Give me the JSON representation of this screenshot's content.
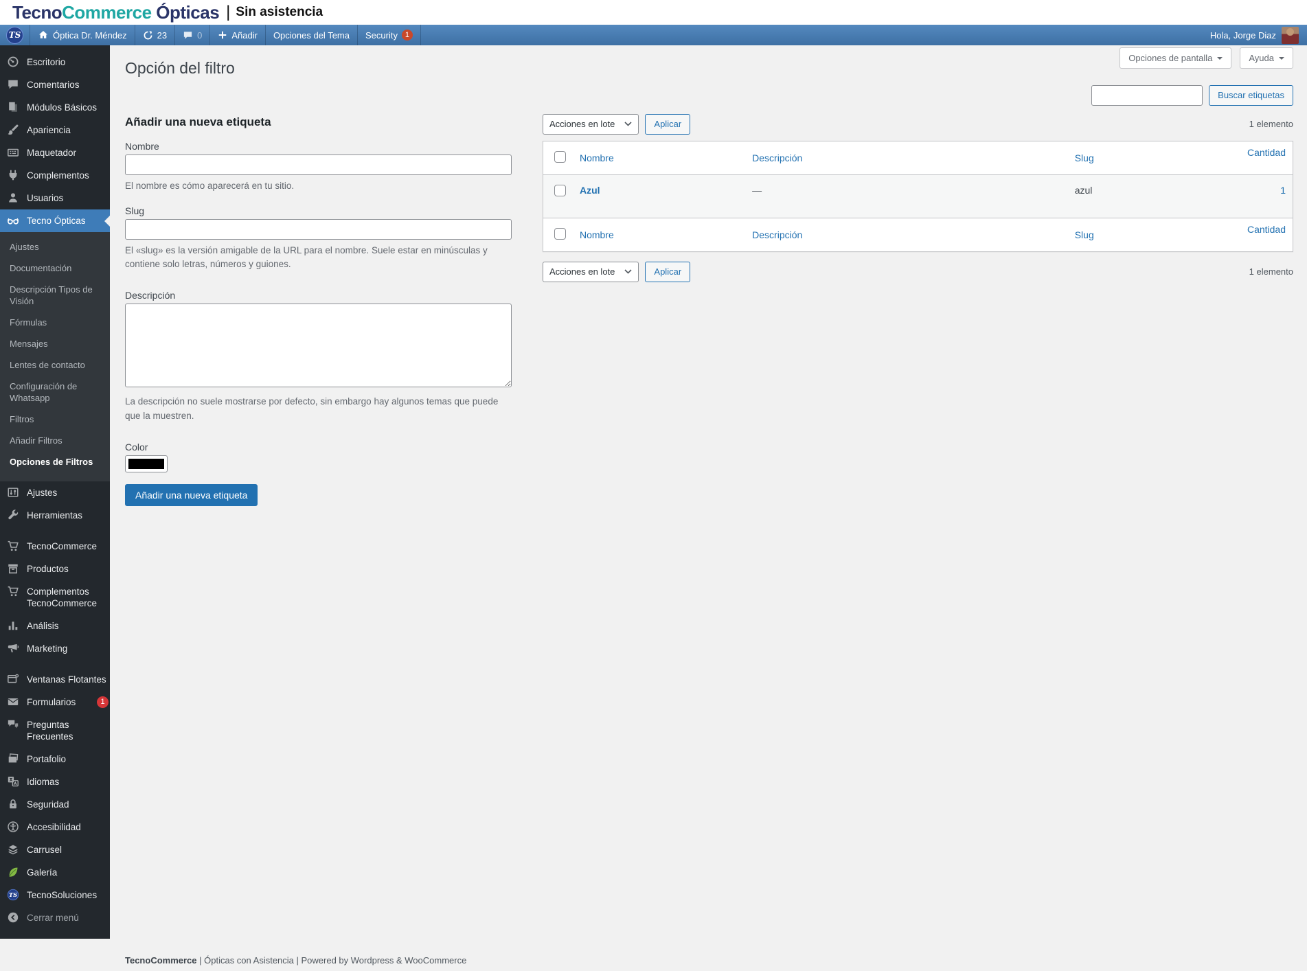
{
  "site_header": {
    "brand_tecno": "Tecno",
    "brand_commerce": "Commerce",
    "brand_opticas": "Ópticas",
    "divider": "|",
    "subtitle": "Sin asistencia"
  },
  "admin_bar": {
    "site_name": "Óptica Dr. Méndez",
    "updates_count": "23",
    "comments_count": "0",
    "new_label": "Añadir",
    "theme_options_label": "Opciones del Tema",
    "security_label": "Security",
    "security_badge": "1",
    "greeting": "Hola, Jorge Diaz"
  },
  "sidebar": {
    "items": [
      {
        "label": "Escritorio",
        "icon": "dashboard-icon"
      },
      {
        "label": "Comentarios",
        "icon": "comments-icon"
      },
      {
        "label": "Módulos Básicos",
        "icon": "pages-icon"
      },
      {
        "label": "Apariencia",
        "icon": "appearance-icon"
      },
      {
        "label": "Maquetador",
        "icon": "builder-icon"
      },
      {
        "label": "Complementos",
        "icon": "plugins-icon"
      },
      {
        "label": "Usuarios",
        "icon": "users-icon"
      },
      {
        "label": "Tecno Ópticas",
        "icon": "glasses-icon",
        "active": true,
        "submenu": [
          {
            "label": "Ajustes"
          },
          {
            "label": "Documentación"
          },
          {
            "label": "Descripción Tipos de Visión"
          },
          {
            "label": "Fórmulas"
          },
          {
            "label": "Mensajes"
          },
          {
            "label": "Lentes de contacto"
          },
          {
            "label": "Configuración de Whatsapp"
          },
          {
            "label": "Filtros"
          },
          {
            "label": "Añadir Filtros"
          },
          {
            "label": "Opciones de Filtros",
            "current": true
          }
        ]
      },
      {
        "label": "Ajustes",
        "icon": "settings-icon"
      },
      {
        "label": "Herramientas",
        "icon": "tools-icon"
      },
      {
        "separator": true
      },
      {
        "label": "TecnoCommerce",
        "icon": "cart-icon"
      },
      {
        "label": "Productos",
        "icon": "products-icon"
      },
      {
        "label": "Complementos TecnoCommerce",
        "icon": "cart-icon"
      },
      {
        "label": "Análisis",
        "icon": "analytics-icon"
      },
      {
        "label": "Marketing",
        "icon": "megaphone-icon"
      },
      {
        "separator": true
      },
      {
        "label": "Ventanas Flotantes",
        "icon": "popup-icon"
      },
      {
        "label": "Formularios",
        "icon": "envelope-icon",
        "badge": "1"
      },
      {
        "label": "Preguntas Frecuentes",
        "icon": "chat-icon"
      },
      {
        "label": "Portafolio",
        "icon": "portfolio-icon"
      },
      {
        "label": "Idiomas",
        "icon": "translate-icon"
      },
      {
        "label": "Seguridad",
        "icon": "lock-icon"
      },
      {
        "label": "Accesibilidad",
        "icon": "accessibility-icon"
      },
      {
        "label": "Carrusel",
        "icon": "layers-icon"
      },
      {
        "label": "Galería",
        "icon": "leaf-icon"
      },
      {
        "label": "TecnoSoluciones",
        "icon": "ts-logo-icon"
      },
      {
        "label": "Cerrar menú",
        "icon": "collapse-icon",
        "muted": true
      }
    ]
  },
  "main": {
    "title": "Opción del filtro",
    "screen_options_label": "Opciones de pantalla",
    "help_label": "Ayuda",
    "form": {
      "heading": "Añadir una nueva etiqueta",
      "name_label": "Nombre",
      "name_help": "El nombre es cómo aparecerá en tu sitio.",
      "slug_label": "Slug",
      "slug_help": "El «slug» es la versión amigable de la URL para el nombre. Suele estar en minúsculas y contiene solo letras, números y guiones.",
      "description_label": "Descripción",
      "description_help": "La descripción no suele mostrarse por defecto, sin embargo hay algunos temas que puede que la muestren.",
      "color_label": "Color",
      "color_value": "#000000",
      "submit_label": "Añadir una nueva etiqueta"
    },
    "list": {
      "search_button": "Buscar etiquetas",
      "bulk_actions_label": "Acciones en lote",
      "apply_label": "Aplicar",
      "items_count": "1 elemento",
      "columns": [
        "Nombre",
        "Descripción",
        "Slug",
        "Cantidad"
      ],
      "rows": [
        {
          "name": "Azul",
          "description": "—",
          "slug": "azul",
          "count": "1"
        }
      ]
    }
  },
  "footer": {
    "brand": "TecnoCommerce",
    "rest": " | Ópticas con Asistencia | Powered by Wordpress & WooCommerce"
  },
  "colors": {
    "accent": "#2271b1",
    "menu_highlight": "#3e7cb8",
    "admin_bar_top": "#5489bf",
    "admin_bar_bottom": "#3e70a4",
    "brand_navy": "#2a3468",
    "brand_teal": "#1fa7a3",
    "forms_badge": "#d63638",
    "security_badge": "#c9482a",
    "sidebar_bg": "#23282d",
    "submenu_bg": "#32373c",
    "content_bg": "#f1f1f1"
  }
}
